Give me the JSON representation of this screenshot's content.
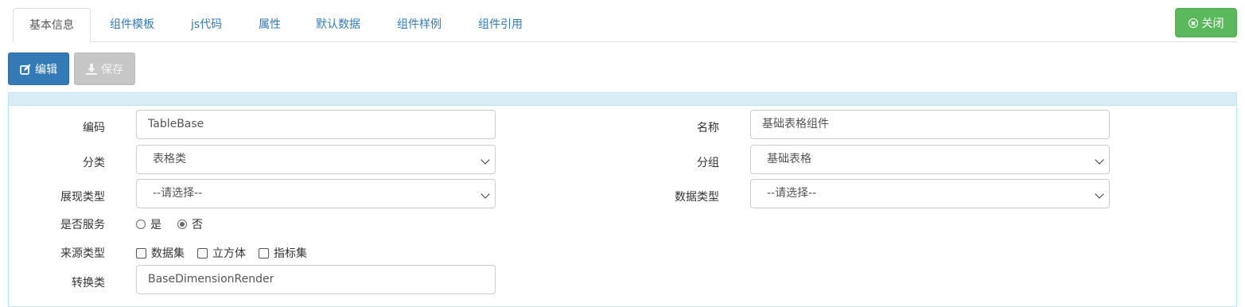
{
  "tabs": [
    {
      "label": "基本信息",
      "active": true
    },
    {
      "label": "组件模板"
    },
    {
      "label": "js代码"
    },
    {
      "label": "属性"
    },
    {
      "label": "默认数据"
    },
    {
      "label": "组件样例"
    },
    {
      "label": "组件引用"
    }
  ],
  "toolbar": {
    "close_label": "关闭",
    "edit_label": "编辑",
    "save_label": "保存"
  },
  "form": {
    "code_label": "编码",
    "code_value": "TableBase",
    "name_label": "名称",
    "name_value": "基础表格组件",
    "category_label": "分类",
    "category_value": "表格类",
    "group_label": "分组",
    "group_value": "基础表格",
    "display_type_label": "展现类型",
    "display_type_value": "--请选择--",
    "data_type_label": "数据类型",
    "data_type_value": "--请选择--",
    "is_service_label": "是否服务",
    "is_service_yes": "是",
    "is_service_no": "否",
    "is_service_selected": "否",
    "source_type_label": "来源类型",
    "source_opt1": "数据集",
    "source_opt2": "立方体",
    "source_opt3": "指标集",
    "converter_label": "转换类",
    "converter_value": "BaseDimensionRender"
  },
  "colors": {
    "primary": "#337ab7",
    "success": "#5cb85c",
    "panel_head": "#d9edf7"
  }
}
